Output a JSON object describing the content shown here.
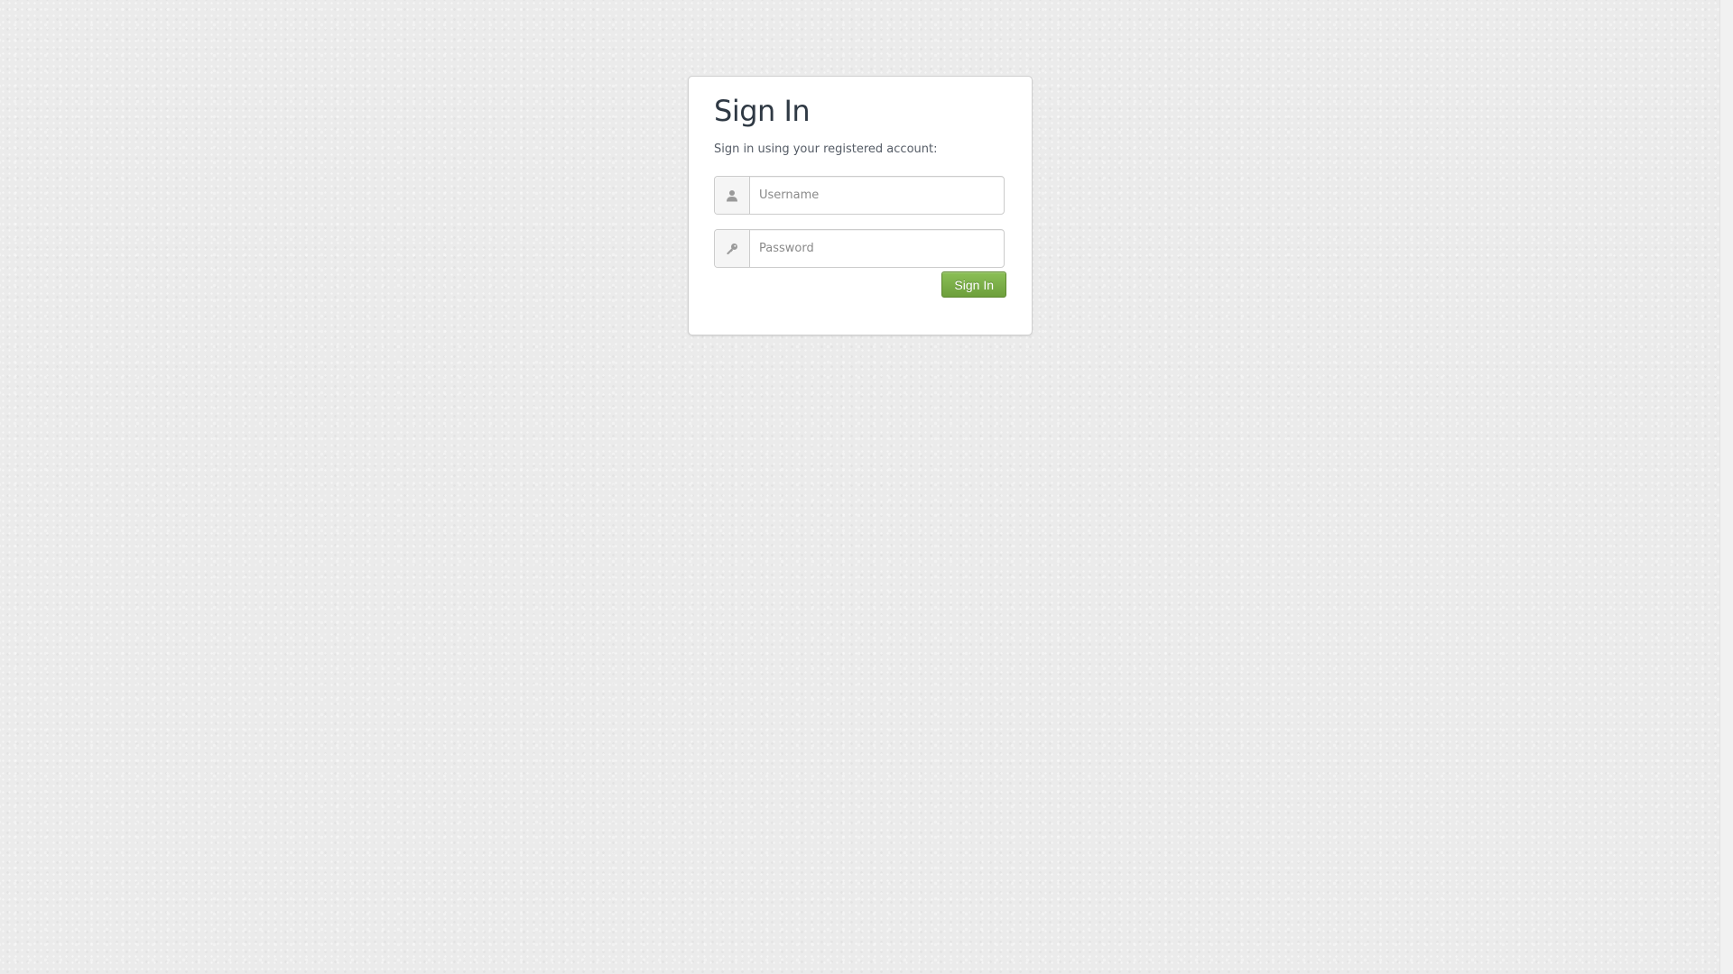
{
  "login": {
    "title": "Sign In",
    "subtitle": "Sign in using your registered account:",
    "username": {
      "icon": "user-icon",
      "placeholder": "Username",
      "value": ""
    },
    "password": {
      "icon": "key-icon",
      "placeholder": "Password",
      "value": ""
    },
    "submit_label": "Sign In"
  },
  "colors": {
    "page_background": "#ebebeb",
    "title_text": "#2f3944",
    "button_green": "#7aac48",
    "button_border": "#5f8a32",
    "icon_gray": "#999999"
  }
}
